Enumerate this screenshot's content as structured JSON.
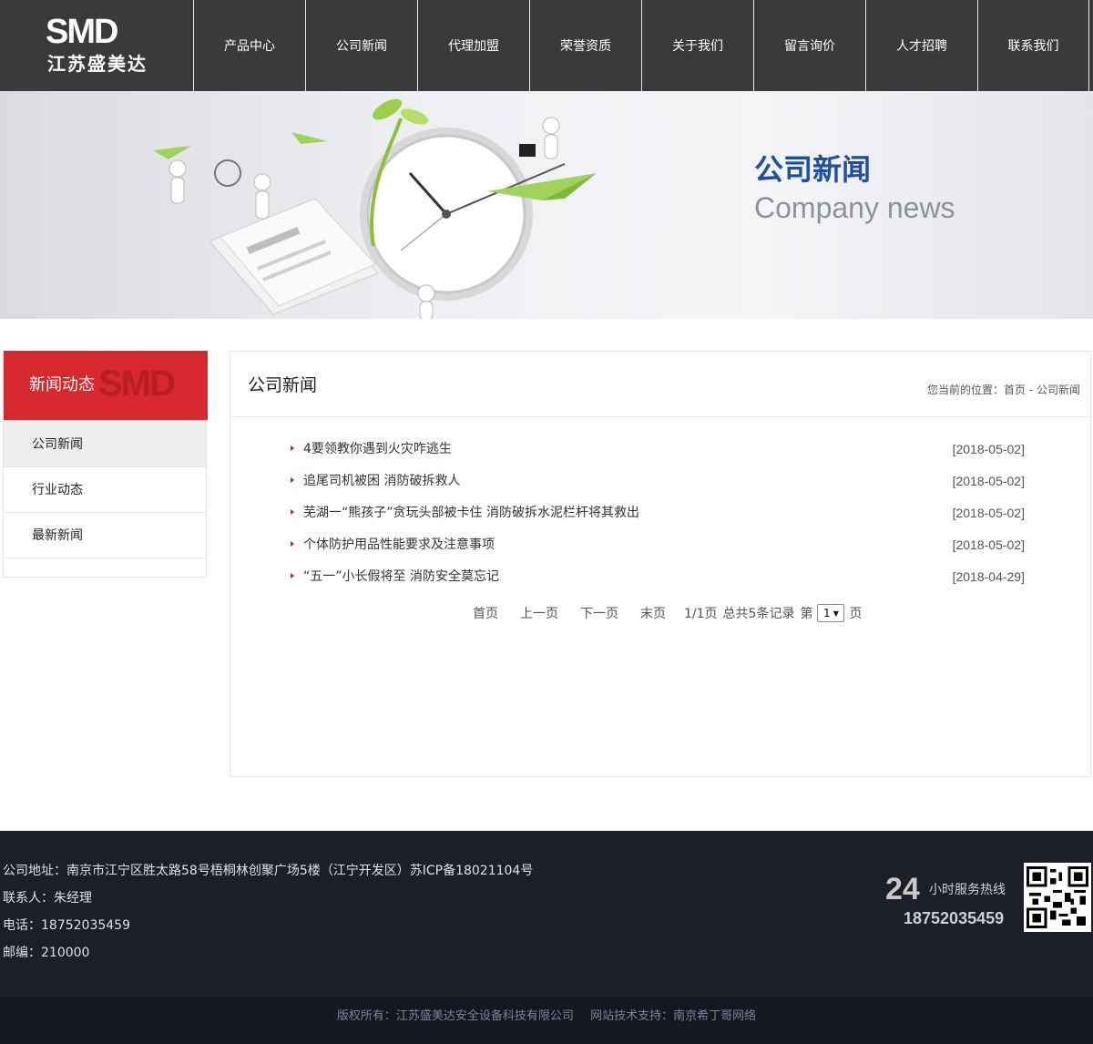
{
  "header": {
    "logo_mark": "SMD",
    "logo_text": "江苏盛美达",
    "nav": [
      "产品中心",
      "公司新闻",
      "代理加盟",
      "荣誉资质",
      "关于我们",
      "留言询价",
      "人才招聘",
      "联系我们"
    ]
  },
  "banner": {
    "title": "公司新闻",
    "subtitle": "Company news"
  },
  "sidebar": {
    "title": "新闻动态",
    "watermark": "SMD",
    "items": [
      "公司新闻",
      "行业动态",
      "最新新闻"
    ]
  },
  "main": {
    "title": "公司新闻",
    "breadcrumb": {
      "label": "您当前的位置：",
      "home": "首页",
      "sep": " - ",
      "current": "公司新闻"
    },
    "news": [
      {
        "title": "4要领教你遇到火灾咋逃生",
        "date": "[2018-05-02]"
      },
      {
        "title": "追尾司机被困 消防破拆救人",
        "date": "[2018-05-02]"
      },
      {
        "title": "芜湖一“熊孩子”贪玩头部被卡住 消防破拆水泥栏杆将其救出",
        "date": "[2018-05-02]"
      },
      {
        "title": "个体防护用品性能要求及注意事项",
        "date": "[2018-05-02]"
      },
      {
        "title": "“五一”小长假将至 消防安全莫忘记",
        "date": "[2018-04-29]"
      }
    ],
    "pager": {
      "first": "首页",
      "prev": "上一页",
      "next": "下一页",
      "last": "末页",
      "page_info": "1/1页",
      "total": "总共5条记录",
      "goto_prefix": "第",
      "selected_page": "1",
      "goto_suffix": "页"
    }
  },
  "footer": {
    "address": "公司地址：南京市江宁区胜太路58号梧桐林创聚广场5楼（江宁开发区）",
    "icp": "苏ICP备18021104号",
    "contact": "联系人：朱经理",
    "phone": "电话：18752035459",
    "postcode": "邮编：210000",
    "hotline_num": "24",
    "hotline_label": "小时服务热线",
    "hotline_phone": "18752035459",
    "copyright": "版权所有：江苏盛美达安全设备科技有限公司",
    "tech_support": "网站技术支持：南京希丁哥网络"
  },
  "colors": {
    "header_bg": "#3a3a3a",
    "accent_red": "#d7282d",
    "banner_title": "#1f4ea5",
    "footer_bg": "#1c1f29"
  }
}
